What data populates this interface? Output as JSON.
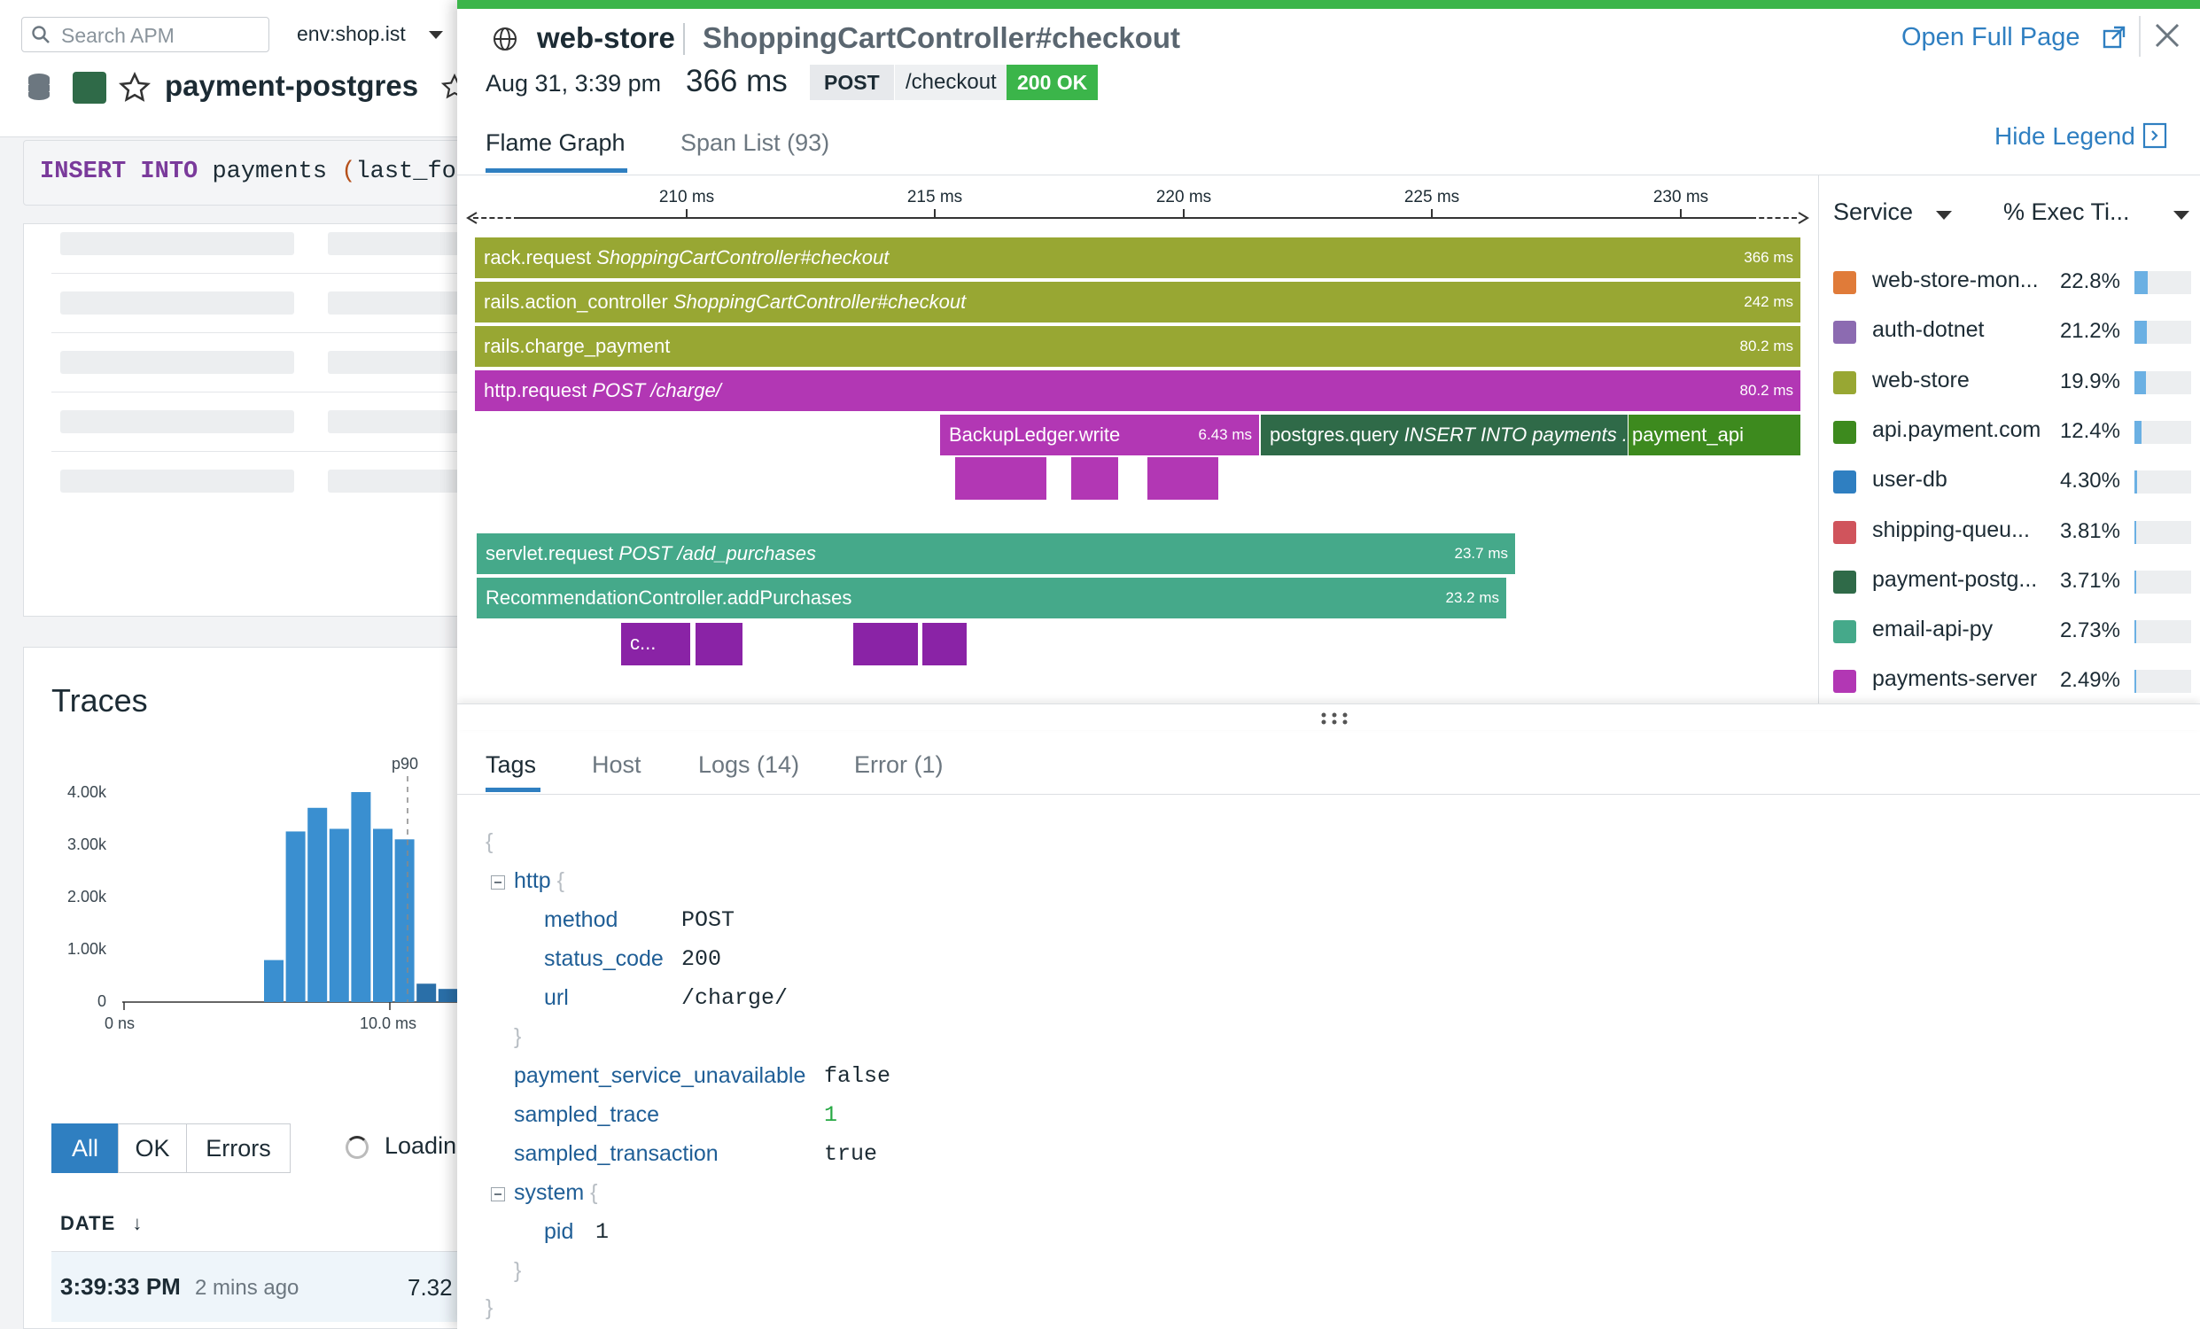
{
  "background": {
    "search": {
      "placeholder": "Search APM"
    },
    "env": "env:shop.ist",
    "service_title": "payment-postgres",
    "sql": {
      "kw1": "INSERT",
      "kw2": "INTO",
      "table": "payments",
      "paren": "(",
      "rest": "last_fou"
    },
    "traces_title": "Traces",
    "histogram": {
      "type": "bar",
      "y_ticks": [
        "4.00k",
        "3.00k",
        "2.00k",
        "1.00k",
        "0"
      ],
      "x_ticks": [
        "0 ns",
        "10.0 ms"
      ],
      "ylim": [
        0,
        4000
      ],
      "values": [
        800,
        3250,
        3700,
        3300,
        4000,
        3300,
        3100,
        350,
        250,
        300
      ],
      "p90_label": "p90"
    },
    "filters": [
      "All",
      "OK",
      "Errors"
    ],
    "loading_text": "Loadin",
    "date_header": "DATE",
    "date_arrow": "↓",
    "first_row": {
      "time": "3:39:33 PM",
      "ago": "2 mins ago",
      "value": "7.32"
    }
  },
  "panel": {
    "service": "web-store",
    "resource": "ShoppingCartController#checkout",
    "open_full_page": "Open Full Page",
    "date": "Aug 31, 3:39 pm",
    "duration": "366 ms",
    "method": "POST",
    "url": "/checkout",
    "status": "200 OK",
    "tabs": {
      "flame": "Flame Graph",
      "spans": "Span List (93)"
    },
    "hide_legend": "Hide Legend",
    "axis_ticks": [
      "210 ms",
      "215 ms",
      "220 ms",
      "225 ms",
      "230 ms"
    ],
    "spans": [
      {
        "op": "rack.request",
        "res": "ShoppingCartController#checkout",
        "dur": "366 ms"
      },
      {
        "op": "rails.action_controller",
        "res": "ShoppingCartController#checkout",
        "dur": "242 ms"
      },
      {
        "op": "rails.charge_payment",
        "res": "",
        "dur": "80.2 ms"
      },
      {
        "op": "http.request",
        "res": "POST /charge/",
        "dur": "80.2 ms"
      },
      {
        "op": "BackupLedger.write",
        "res": "",
        "dur": "6.43 ms"
      },
      {
        "op": "postgres.query",
        "res": "INSERT INTO payments ...",
        "dur": ""
      },
      {
        "op": "payment_api",
        "res": "",
        "dur": ""
      },
      {
        "op": "servlet.request",
        "res": "POST /add_purchases",
        "dur": "23.7 ms"
      },
      {
        "op": "RecommendationController.addPurchases",
        "res": "",
        "dur": "23.2 ms"
      },
      {
        "op": "c...",
        "res": "",
        "dur": ""
      }
    ],
    "legend": {
      "col_service": "Service",
      "col_exec": "% Exec Ti...",
      "rows": [
        {
          "name": "web-store-mon...",
          "pct": "22.8%",
          "frac": 0.228,
          "color": "#e07b39"
        },
        {
          "name": "auth-dotnet",
          "pct": "21.2%",
          "frac": 0.212,
          "color": "#8c6bb1"
        },
        {
          "name": "web-store",
          "pct": "19.9%",
          "frac": 0.199,
          "color": "#98a733"
        },
        {
          "name": "api.payment.com",
          "pct": "12.4%",
          "frac": 0.124,
          "color": "#3d8a1e"
        },
        {
          "name": "user-db",
          "pct": "4.30%",
          "frac": 0.043,
          "color": "#2f7fc1"
        },
        {
          "name": "shipping-queu...",
          "pct": "3.81%",
          "frac": 0.0381,
          "color": "#d0545c"
        },
        {
          "name": "payment-postg...",
          "pct": "3.71%",
          "frac": 0.0371,
          "color": "#2f6a48"
        },
        {
          "name": "email-api-py",
          "pct": "2.73%",
          "frac": 0.0273,
          "color": "#45a98a"
        },
        {
          "name": "payments-server",
          "pct": "2.49%",
          "frac": 0.0249,
          "color": "#b237b4"
        }
      ]
    },
    "bottom_tabs": [
      "Tags",
      "Host",
      "Logs (14)",
      "Error (1)"
    ],
    "tags": {
      "open_brace": "{",
      "close_brace": "}",
      "http_key": "http",
      "method_key": "method",
      "method_val": "POST",
      "status_key": "status_code",
      "status_val": "200",
      "url_key": "url",
      "url_val": "/charge/",
      "psu_key": "payment_service_unavailable",
      "psu_val": "false",
      "st_key": "sampled_trace",
      "st_val": "1",
      "stx_key": "sampled_transaction",
      "stx_val": "true",
      "system_key": "system",
      "pid_key": "pid",
      "pid_val": "1"
    }
  }
}
